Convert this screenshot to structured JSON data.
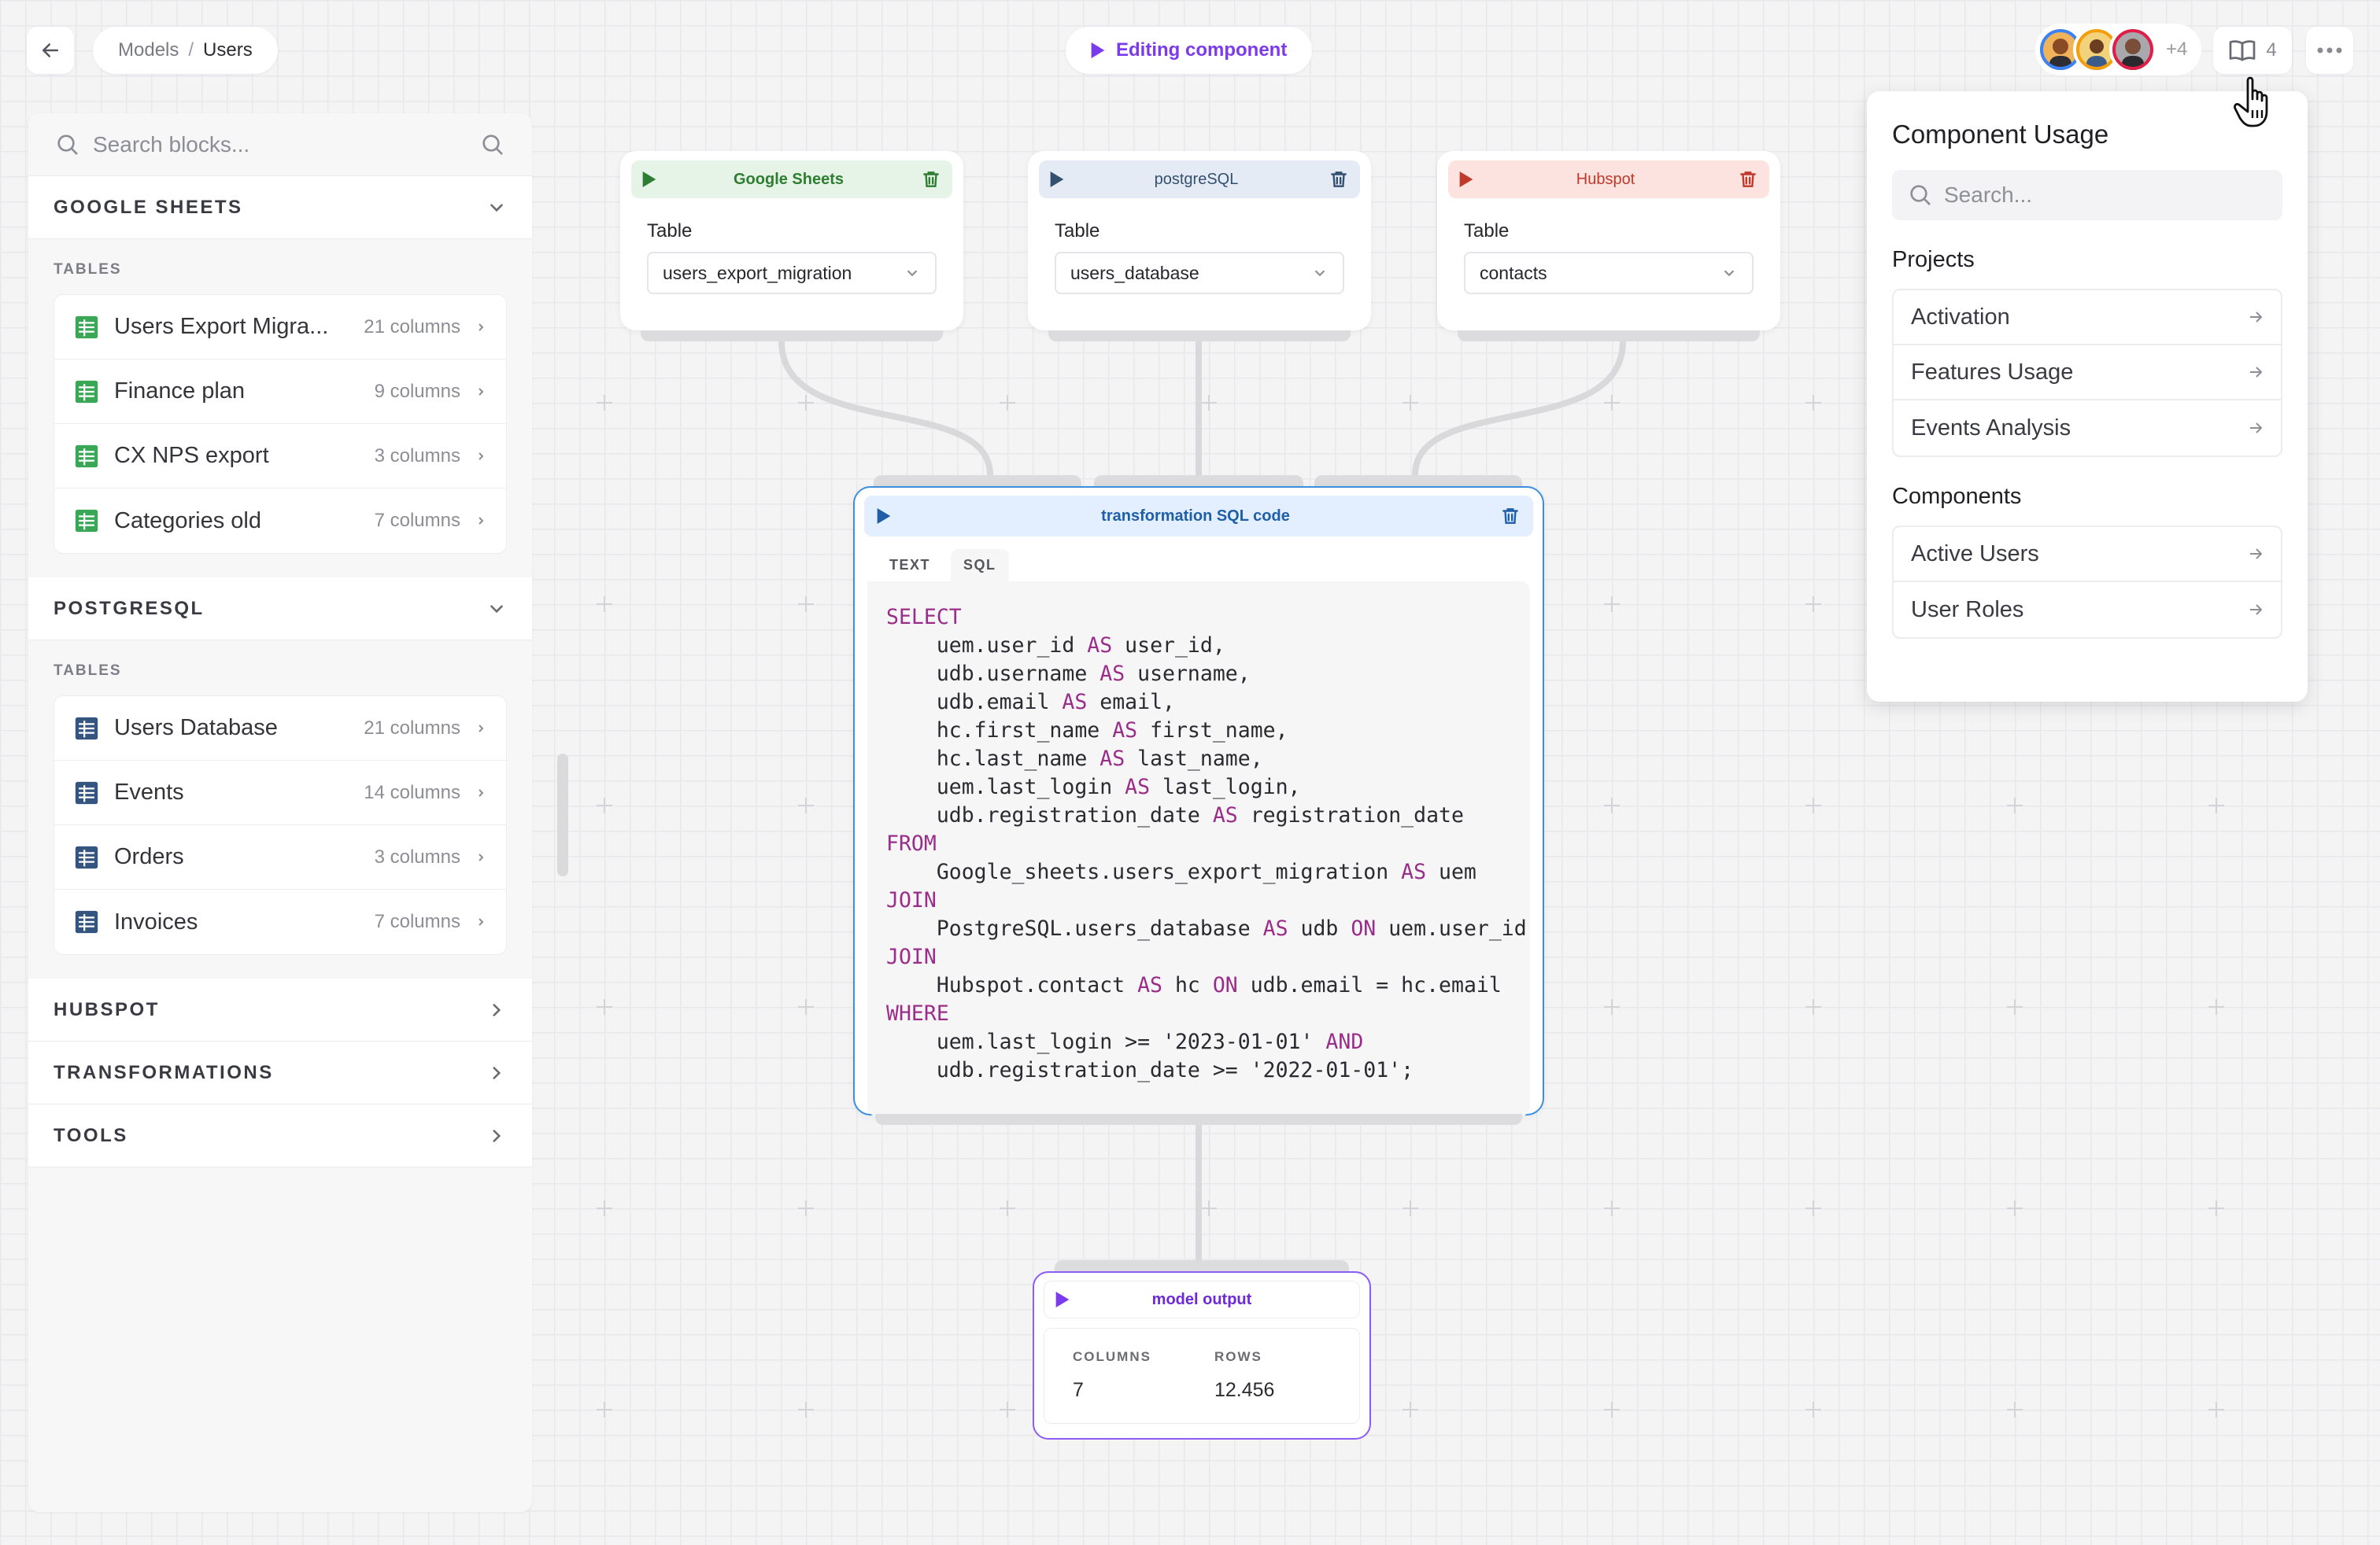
{
  "header": {
    "breadcrumb": {
      "parent": "Models",
      "separator": "/",
      "current": "Users"
    },
    "editing_label": "Editing component",
    "collaborators_more": "+4",
    "docs_count": "4"
  },
  "sidebar": {
    "search_placeholder": "Search blocks...",
    "groups": [
      {
        "title": "GOOGLE SHEETS",
        "section_label": "TABLES",
        "tables": [
          {
            "name": "Users Export Migra...",
            "columns": "21 columns"
          },
          {
            "name": "Finance plan",
            "columns": "9 columns"
          },
          {
            "name": "CX NPS export",
            "columns": "3 columns"
          },
          {
            "name": "Categories old",
            "columns": "7 columns"
          }
        ]
      },
      {
        "title": "POSTGRESQL",
        "section_label": "TABLES",
        "tables": [
          {
            "name": "Users Database",
            "columns": "21 columns"
          },
          {
            "name": "Events",
            "columns": "14 columns"
          },
          {
            "name": "Orders",
            "columns": "3 columns"
          },
          {
            "name": "Invoices",
            "columns": "7 columns"
          }
        ]
      }
    ],
    "collapsed_groups": [
      "HUBSPOT",
      "TRANSFORMATIONS",
      "TOOLS"
    ]
  },
  "sources": [
    {
      "title": "Google Sheets",
      "field_label": "Table",
      "value": "users_export_migration",
      "color": "#2e7d32",
      "bg": "#e5f4e6"
    },
    {
      "title": "postgreSQL",
      "field_label": "Table",
      "value": "users_database",
      "color": "#33506e",
      "bg": "#e4ebf5"
    },
    {
      "title": "Hubspot",
      "field_label": "Table",
      "value": "contacts",
      "color": "#c0392b",
      "bg": "#fde3df"
    }
  ],
  "transformation": {
    "title": "transformation SQL code",
    "tabs": [
      "TEXT",
      "SQL"
    ],
    "code_lines": [
      [
        [
          "kw",
          "SELECT"
        ]
      ],
      [
        [
          "t",
          "    uem.user_id "
        ],
        [
          "kw",
          "AS"
        ],
        [
          "t",
          " user_id,"
        ]
      ],
      [
        [
          "t",
          "    udb.username "
        ],
        [
          "kw",
          "AS"
        ],
        [
          "t",
          " username,"
        ]
      ],
      [
        [
          "t",
          "    udb.email "
        ],
        [
          "kw",
          "AS"
        ],
        [
          "t",
          " email,"
        ]
      ],
      [
        [
          "t",
          "    hc.first_name "
        ],
        [
          "kw",
          "AS"
        ],
        [
          "t",
          " first_name,"
        ]
      ],
      [
        [
          "t",
          "    hc.last_name "
        ],
        [
          "kw",
          "AS"
        ],
        [
          "t",
          " last_name,"
        ]
      ],
      [
        [
          "t",
          "    uem.last_login "
        ],
        [
          "kw",
          "AS"
        ],
        [
          "t",
          " last_login,"
        ]
      ],
      [
        [
          "t",
          "    udb.registration_date "
        ],
        [
          "kw",
          "AS"
        ],
        [
          "t",
          " registration_date"
        ]
      ],
      [
        [
          "kw",
          "FROM"
        ]
      ],
      [
        [
          "t",
          "    Google_sheets.users_export_migration "
        ],
        [
          "kw",
          "AS"
        ],
        [
          "t",
          " uem"
        ]
      ],
      [
        [
          "kw",
          "JOIN"
        ]
      ],
      [
        [
          "t",
          "    PostgreSQL.users_database "
        ],
        [
          "kw",
          "AS"
        ],
        [
          "t",
          " udb "
        ],
        [
          "kw",
          "ON"
        ],
        [
          "t",
          " uem.user_id"
        ]
      ],
      [
        [
          "kw",
          "JOIN"
        ]
      ],
      [
        [
          "t",
          "    Hubspot.contact "
        ],
        [
          "kw",
          "AS"
        ],
        [
          "t",
          " hc "
        ],
        [
          "kw",
          "ON"
        ],
        [
          "t",
          " udb.email = hc.email"
        ]
      ],
      [
        [
          "kw",
          "WHERE"
        ]
      ],
      [
        [
          "t",
          "    uem.last_login >= '2023-01-01' "
        ],
        [
          "kw",
          "AND"
        ]
      ],
      [
        [
          "t",
          "    udb.registration_date >= '2022-01-01';"
        ]
      ]
    ]
  },
  "output": {
    "title": "model output",
    "columns_label": "COLUMNS",
    "columns_value": "7",
    "rows_label": "ROWS",
    "rows_value": "12.456"
  },
  "usage_panel": {
    "title": "Component Usage",
    "search_placeholder": "Search...",
    "projects_heading": "Projects",
    "projects": [
      "Activation",
      "Features Usage",
      "Events Analysis"
    ],
    "components_heading": "Components",
    "components": [
      "Active Users",
      "User Roles"
    ]
  },
  "icons": {
    "back": "arrow-left-icon",
    "play": "play-icon",
    "trash": "trash-icon",
    "docs": "book-open-icon",
    "more": "ellipsis-icon",
    "arrow": "arrow-right-icon",
    "cursor": "pointer-hand-icon"
  },
  "colors": {
    "accent_purple": "#7c3aed",
    "sql_border": "#3b8fe0",
    "sql_keyword": "#9b2d8a",
    "output_border": "#8b5cf6"
  }
}
